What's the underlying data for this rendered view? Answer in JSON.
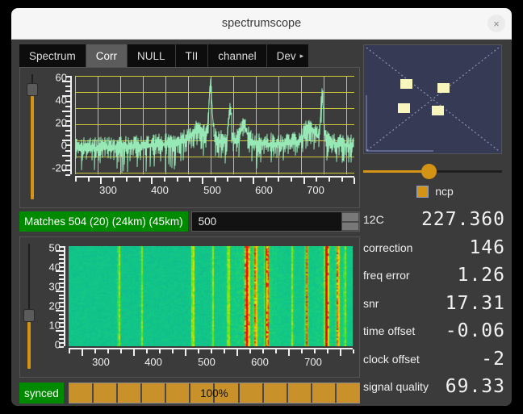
{
  "window": {
    "title": "spectrumscope",
    "close_label": "×"
  },
  "tabs": [
    {
      "label": "Spectrum",
      "active": false
    },
    {
      "label": "Corr",
      "active": true
    },
    {
      "label": "NULL",
      "active": false
    },
    {
      "label": "TII",
      "active": false
    },
    {
      "label": "channel",
      "active": false
    },
    {
      "label": "Dev",
      "active": false,
      "overflow_arrow": "▸"
    }
  ],
  "corr_plot": {
    "y_ticks": [
      "60",
      "40",
      "20",
      "0",
      "-20"
    ],
    "x_ticks": [
      "300",
      "400",
      "500",
      "600",
      "700"
    ],
    "slider_value": 92
  },
  "matches": {
    "badge_text": "Matches  504 (20) (24km) (45km)",
    "spin_value": "500"
  },
  "waterfall": {
    "y_ticks": [
      "50",
      "40",
      "30",
      "20",
      "10",
      "0"
    ],
    "x_ticks": [
      "300",
      "400",
      "500",
      "600",
      "700"
    ],
    "slider_value": 42
  },
  "status": {
    "sync_label": "synced",
    "progress_text": "100%",
    "progress_segments": 12
  },
  "constellation": {
    "points": [
      {
        "x": 52,
        "y": 48
      },
      {
        "x": 98,
        "y": 53
      },
      {
        "x": 49,
        "y": 78
      },
      {
        "x": 91,
        "y": 81
      }
    ],
    "slider_value": 47,
    "legend_label": "ncp",
    "legend_color": "#d39314"
  },
  "readouts": [
    {
      "label": "12C",
      "value": "227.360"
    },
    {
      "label": "correction",
      "value": "146"
    },
    {
      "label": "freq error",
      "value": "1.26"
    },
    {
      "label": "snr",
      "value": "17.31"
    },
    {
      "label": "time offset",
      "value": "-0.06"
    },
    {
      "label": "clock offset",
      "value": "-2"
    },
    {
      "label": "signal quality",
      "value": "69.33"
    }
  ],
  "colors": {
    "accent": "#d39314",
    "green_badge": "#008a00",
    "trace": "#96e8b4",
    "grid": "#d8cf3a",
    "waterfall_base": "#0fb0b0"
  }
}
